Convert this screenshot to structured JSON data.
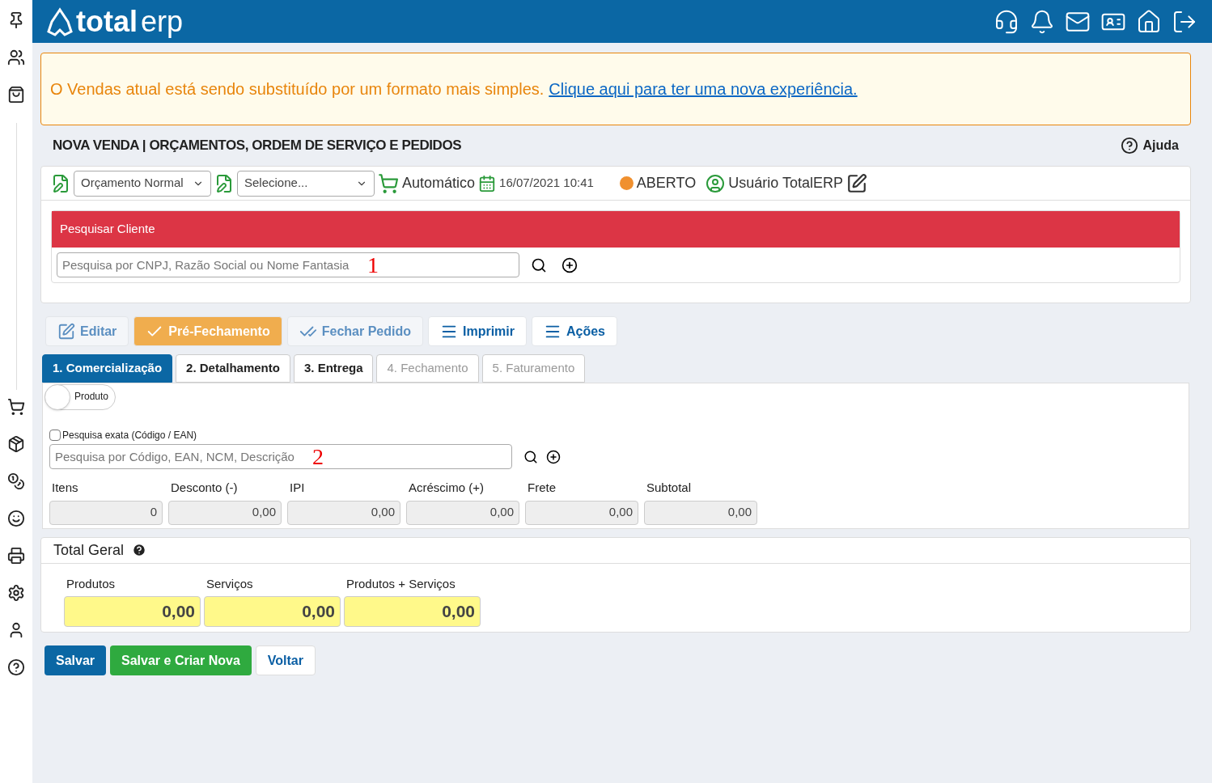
{
  "header": {
    "logo_bold": "total",
    "logo_light": "erp"
  },
  "notice": {
    "text": "O Vendas atual está sendo substituído por um formato mais simples.",
    "link": "Clique aqui para ter uma nova experiência."
  },
  "page": {
    "title": "NOVA VENDA | ORÇAMENTOS, ORDEM DE SERVIÇO E PEDIDOS",
    "help": "Ajuda"
  },
  "toolbar": {
    "type_select": "Orçamento Normal",
    "second_select": "Selecione...",
    "mode": "Automático",
    "datetime": "16/07/2021 10:41",
    "status": {
      "label": "ABERTO",
      "color": "#f0902f"
    },
    "user": "Usuário TotalERP"
  },
  "client_search": {
    "title": "Pesquisar Cliente",
    "placeholder": "Pesquisa por CNPJ, Razão Social ou Nome Fantasia",
    "marker": "1"
  },
  "actions": [
    {
      "label": "Editar",
      "kind": "muted"
    },
    {
      "label": "Pré-Fechamento",
      "kind": "primary"
    },
    {
      "label": "Fechar Pedido",
      "kind": "muted"
    },
    {
      "label": "Imprimir",
      "kind": "menu"
    },
    {
      "label": "Ações",
      "kind": "menu"
    }
  ],
  "tabs": [
    {
      "label": "1. Comercialização",
      "selected": true,
      "disabled": false
    },
    {
      "label": "2. Detalhamento",
      "selected": false,
      "disabled": false
    },
    {
      "label": "3. Entrega",
      "selected": false,
      "disabled": false
    },
    {
      "label": "4. Fechamento",
      "selected": false,
      "disabled": true
    },
    {
      "label": "5. Faturamento",
      "selected": false,
      "disabled": true
    }
  ],
  "product": {
    "toggle_label": "Produto",
    "toggle_on": false,
    "exact_label": "Pesquisa exata (Código / EAN)",
    "exact_checked": false,
    "placeholder": "Pesquisa por Código, EAN, NCM, Descrição",
    "marker": "2"
  },
  "totals": [
    {
      "label": "Itens",
      "value": "0"
    },
    {
      "label": "Desconto (-)",
      "value": "0,00"
    },
    {
      "label": "IPI",
      "value": "0,00"
    },
    {
      "label": "Acréscimo (+)",
      "value": "0,00"
    },
    {
      "label": "Frete",
      "value": "0,00"
    },
    {
      "label": "Subtotal",
      "value": "0,00"
    }
  ],
  "grand_total": {
    "title": "Total Geral",
    "fields": [
      {
        "label": "Produtos",
        "value": "0,00"
      },
      {
        "label": "Serviços",
        "value": "0,00"
      },
      {
        "label": "Produtos + Serviços",
        "value": "0,00"
      }
    ]
  },
  "footer_buttons": [
    {
      "label": "Salvar",
      "kind": "primary"
    },
    {
      "label": "Salvar e Criar Nova",
      "kind": "success"
    },
    {
      "label": "Voltar",
      "kind": "plain"
    }
  ]
}
